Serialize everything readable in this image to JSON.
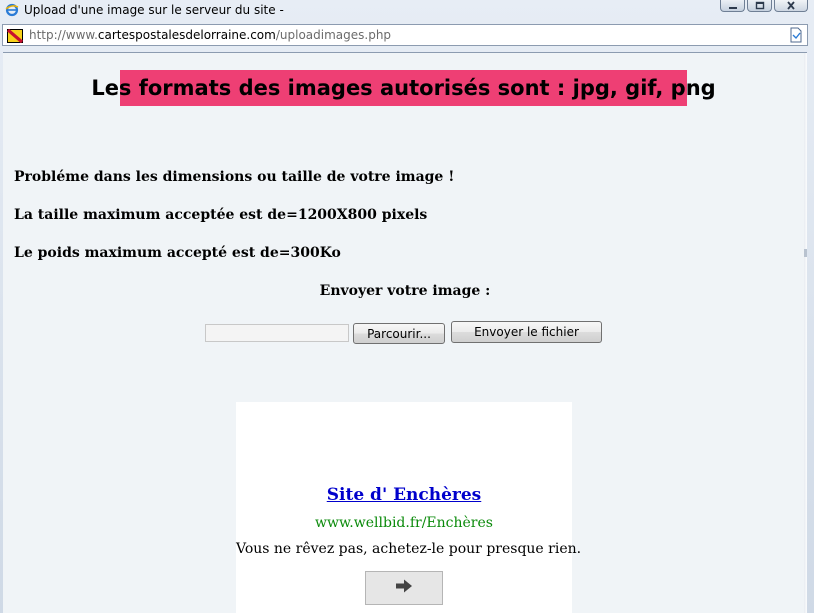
{
  "window": {
    "title": "Upload d'une image sur le serveur du site -",
    "controls": [
      "minimize-icon",
      "maximize-icon",
      "close-icon"
    ]
  },
  "address_bar": {
    "url_prefix": "http://www.",
    "url_domain": "cartespostalesdelorraine.com",
    "url_path": "/uploadimages.php",
    "site_icon": "lorraine-flag-icon",
    "page_icon": "page-compat-icon"
  },
  "page": {
    "banner": "Les formats des images autorisés sont : jpg, gif, png",
    "error_message": "Probléme dans les dimensions ou taille de votre image !",
    "max_size": "La taille maximum acceptée est de=1200X800 pixels",
    "max_weight": "Le poids maximum accepté est de=300Ko",
    "send_label": "Envoyer votre image :",
    "file_input_value": "",
    "browse_label": "Parcourir...",
    "send_button_label": "Envoyer le fichier"
  },
  "ad": {
    "title": "Site d' Enchères",
    "url": "www.wellbid.fr/Enchères",
    "text": "Vous ne rêvez pas, achetez-le pour presque rien.",
    "go_icon": "arrow-right-icon"
  },
  "colors": {
    "banner_bg": "#ee3f74",
    "ad_title": "#0000cc",
    "ad_url": "#0a8a0a",
    "content_bg": "#f0f4f7"
  }
}
